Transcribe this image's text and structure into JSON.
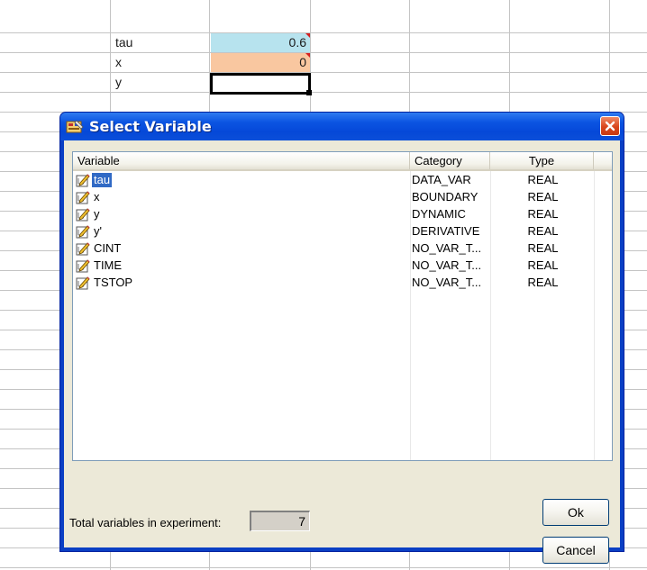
{
  "sheet": {
    "cells": [
      {
        "name": "tau",
        "value": "0.6",
        "fill": "#b7e3ee",
        "has_comment": true
      },
      {
        "name": "x",
        "value": "0",
        "fill": "#f9c7a0",
        "has_comment": true
      },
      {
        "name": "y",
        "value": "",
        "fill": "#ffffff",
        "has_comment": false,
        "selected": true
      }
    ]
  },
  "dialog": {
    "title": "Select Variable",
    "title_icon": "select-variable-icon",
    "close_icon": "close-icon",
    "columns": {
      "variable": "Variable",
      "category": "Category",
      "type": "Type"
    },
    "rows": [
      {
        "name": "tau",
        "category": "DATA_VAR",
        "type": "REAL",
        "selected": true,
        "icon": "variable-pencil-icon"
      },
      {
        "name": "x",
        "category": "BOUNDARY",
        "type": "REAL",
        "selected": false,
        "icon": "variable-pencil-icon"
      },
      {
        "name": "y",
        "category": "DYNAMIC",
        "type": "REAL",
        "selected": false,
        "icon": "variable-pencil-icon"
      },
      {
        "name": "y'",
        "category": "DERIVATIVE",
        "type": "REAL",
        "selected": false,
        "icon": "variable-pencil-icon"
      },
      {
        "name": "CINT",
        "category": "NO_VAR_T...",
        "type": "REAL",
        "selected": false,
        "icon": "variable-pencil-icon"
      },
      {
        "name": "TIME",
        "category": "NO_VAR_T...",
        "type": "REAL",
        "selected": false,
        "icon": "variable-pencil-icon"
      },
      {
        "name": "TSTOP",
        "category": "NO_VAR_T...",
        "type": "REAL",
        "selected": false,
        "icon": "variable-pencil-icon"
      }
    ],
    "total_label": "Total variables in experiment:",
    "total_value": "7",
    "ok_label": "Ok",
    "cancel_label": "Cancel"
  },
  "colors": {
    "title_bar": "#0b54e2",
    "selection": "#316ac5",
    "dialog_face": "#ece9d8"
  }
}
